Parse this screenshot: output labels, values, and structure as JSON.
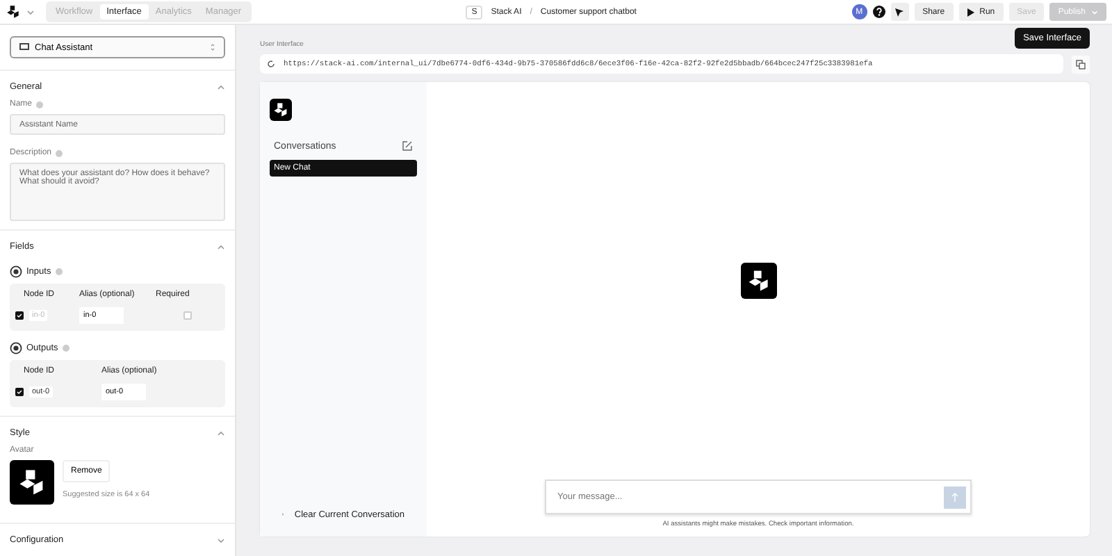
{
  "topbar": {
    "tabs": [
      {
        "label": "Workflow",
        "selected": false
      },
      {
        "label": "Interface",
        "selected": true
      },
      {
        "label": "Analytics",
        "selected": false
      },
      {
        "label": "Manager",
        "selected": false
      }
    ],
    "project_badge": "S",
    "project": "Stack AI",
    "separator": "/",
    "page_title": "Customer support chatbot",
    "avatar": "M",
    "buttons": [
      {
        "label": "Share",
        "kind": "plain",
        "disabled": false
      },
      {
        "label": "Run",
        "kind": "run",
        "disabled": false
      },
      {
        "label": "Save",
        "kind": "plain",
        "disabled": true
      },
      {
        "label": "Publish",
        "kind": "split",
        "disabled": true
      }
    ]
  },
  "left_panel": {
    "interface_type": "Chat Assistant",
    "sections": [
      {
        "kind": "general",
        "title": "General",
        "expanded": true,
        "name_label": "Name",
        "name_placeholder": "Assistant Name",
        "description_label": "Description",
        "description_placeholder": "What does your assistant do? How does it behave? What should it avoid?"
      },
      {
        "kind": "fields",
        "title": "Fields",
        "expanded": true,
        "groups": [
          {
            "title": "Inputs",
            "columns": [
              "Node ID",
              "Alias (optional)",
              "Required"
            ],
            "rows": [
              {
                "checked": true,
                "node_id": "in-0",
                "alias": "in-0",
                "required": false
              }
            ]
          },
          {
            "title": "Outputs",
            "columns": [
              "Node ID",
              "Alias (optional)"
            ],
            "rows": [
              {
                "checked": true,
                "node_id": "out-0",
                "alias": "out-0"
              }
            ]
          }
        ]
      },
      {
        "kind": "style",
        "title": "Style",
        "expanded": true,
        "avatar_label": "Avatar",
        "remove": "Remove",
        "hint": "Suggested size is 64 x 64"
      },
      {
        "kind": "configuration",
        "title": "Configuration",
        "expanded": false
      }
    ]
  },
  "preview": {
    "label": "User Interface",
    "save_button": "Save Interface",
    "url": "https://stack-ai.com/internal_ui/7dbe6774-0df6-434d-9b75-370586fdd6c8/6ece3f06-f16e-42ca-82f2-92fe2d5bbadb/664bcec247f25c3383981efa",
    "sidebar": {
      "title": "Conversations",
      "chats": [
        {
          "label": "New Chat",
          "selected": true
        }
      ],
      "clear": "Clear Current Conversation"
    },
    "message_placeholder": "Your message...",
    "disclaimer": "AI assistants might make mistakes. Check important information."
  }
}
